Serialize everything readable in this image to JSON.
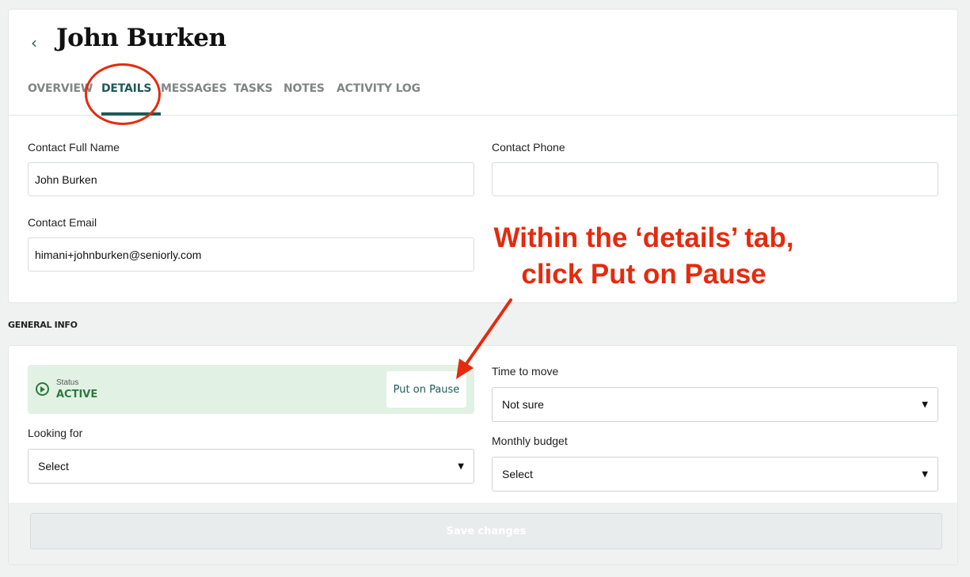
{
  "header": {
    "back_icon": "chevron-left-icon",
    "title": "John Burken"
  },
  "tabs": [
    {
      "label": "OVERVIEW",
      "active": false
    },
    {
      "label": "DETAILS",
      "active": true
    },
    {
      "label": "MESSAGES",
      "active": false
    },
    {
      "label": "TASKS",
      "active": false
    },
    {
      "label": "NOTES",
      "active": false
    },
    {
      "label": "ACTIVITY LOG",
      "active": false
    }
  ],
  "contact": {
    "full_name_label": "Contact Full Name",
    "full_name_value": "John Burken",
    "phone_label": "Contact Phone",
    "phone_value": "",
    "email_label": "Contact Email",
    "email_value": "himani+johnburken@seniorly.com"
  },
  "general_info": {
    "section_title": "GENERAL INFO",
    "status": {
      "icon": "play-circle-icon",
      "label": "Status",
      "value": "ACTIVE",
      "pause_button": "Put on Pause"
    },
    "time_to_move_label": "Time to move",
    "time_to_move_value": "Not sure",
    "looking_for_label": "Looking for",
    "looking_for_value": "Select",
    "monthly_budget_label": "Monthly budget",
    "monthly_budget_value": "Select",
    "save_button": "Save changes"
  },
  "annotation": {
    "line1": "Within the ‘details’ tab,",
    "line2": "click Put on Pause",
    "color": "#e52a0e"
  },
  "colors": {
    "accent": "#1f5a57",
    "status_bg": "#e1f1e4",
    "status_green": "#2d7a3d"
  }
}
